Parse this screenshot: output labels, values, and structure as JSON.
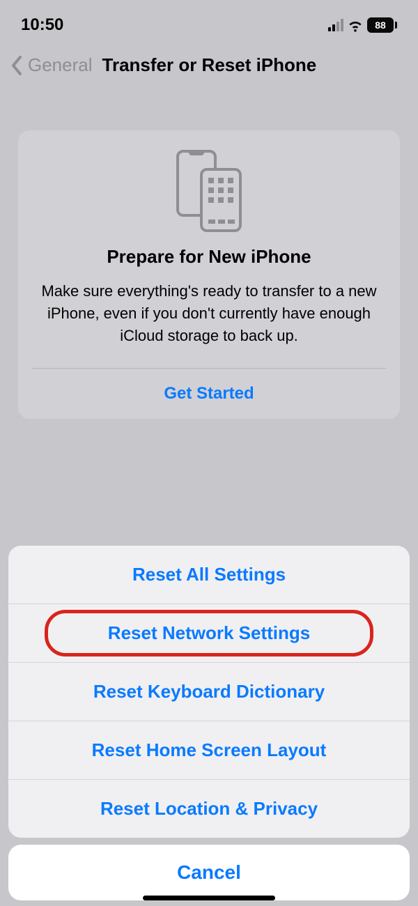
{
  "status": {
    "time": "10:50",
    "battery_percent": "88"
  },
  "nav": {
    "back_label": "General",
    "title": "Transfer or Reset iPhone"
  },
  "card": {
    "title": "Prepare for New iPhone",
    "description": "Make sure everything's ready to transfer to a new iPhone, even if you don't currently have enough iCloud storage to back up.",
    "action_label": "Get Started"
  },
  "sheet": {
    "items": [
      {
        "label": "Reset All Settings"
      },
      {
        "label": "Reset Network Settings"
      },
      {
        "label": "Reset Keyboard Dictionary"
      },
      {
        "label": "Reset Home Screen Layout"
      },
      {
        "label": "Reset Location & Privacy"
      }
    ],
    "cancel_label": "Cancel",
    "highlighted_index": 1
  }
}
